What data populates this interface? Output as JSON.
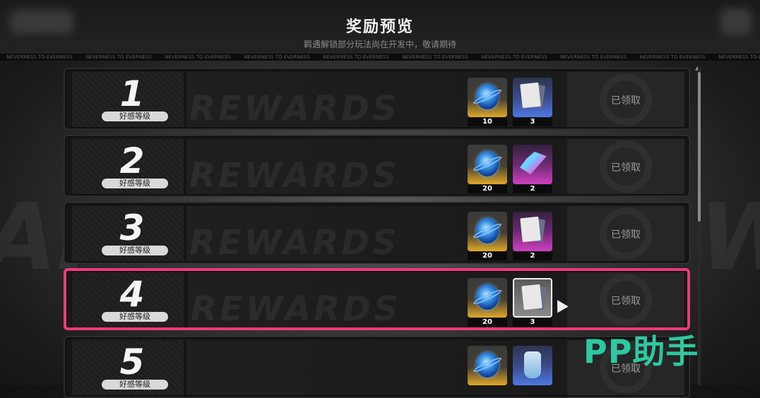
{
  "header": {
    "title": "奖励预览",
    "subtitle": "羁遇解锁部分玩法尚在开发中，敬请期待",
    "ticker_text": "NEVERNESS TO EVERNESS"
  },
  "background": {
    "word": "REWARDS"
  },
  "level_label": "好感等级",
  "claimed_label": "已领取",
  "rows": [
    {
      "level": "1",
      "items": [
        {
          "icon": "blue-orb-icon",
          "count": "10",
          "rarity": "gold"
        },
        {
          "icon": "card-icon",
          "count": "3",
          "rarity": "blue"
        }
      ]
    },
    {
      "level": "2",
      "items": [
        {
          "icon": "blue-orb-icon",
          "count": "20",
          "rarity": "gold"
        },
        {
          "icon": "sparkle-icon",
          "count": "2",
          "rarity": "pink"
        }
      ]
    },
    {
      "level": "3",
      "items": [
        {
          "icon": "blue-orb-icon",
          "count": "20",
          "rarity": "gold"
        },
        {
          "icon": "card-icon",
          "count": "2",
          "rarity": "pink"
        }
      ]
    },
    {
      "level": "4",
      "items": [
        {
          "icon": "blue-orb-icon",
          "count": "20",
          "rarity": "gold"
        },
        {
          "icon": "card-icon",
          "count": "3",
          "rarity": "grey"
        }
      ],
      "selected": true
    },
    {
      "level": "5",
      "items": [
        {
          "icon": "blue-orb-icon",
          "count": "",
          "rarity": "gold"
        },
        {
          "icon": "bottle-icon",
          "count": "",
          "rarity": "blue"
        }
      ]
    }
  ],
  "watermark": "PP助手",
  "colors": {
    "accent": "#f0387a",
    "watermark": "#2fc8a0"
  }
}
